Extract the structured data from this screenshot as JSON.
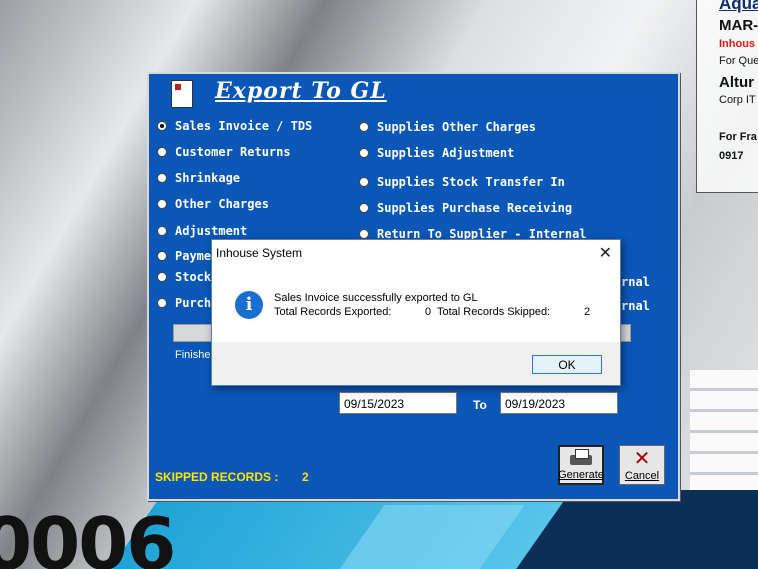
{
  "background": {
    "big_text": "0006",
    "info_panel": {
      "line1": "Aqua",
      "line2": "MAR-",
      "line3": "Inhous",
      "line4": "For Que",
      "line5": "Altur",
      "line6": "Corp IT",
      "line7": "For Fra",
      "line8": "0917"
    }
  },
  "window": {
    "title": "Export To GL",
    "options_left": [
      {
        "label": "Sales Invoice / TDS",
        "selected": true
      },
      {
        "label": "Customer Returns",
        "selected": false
      },
      {
        "label": "Shrinkage",
        "selected": false
      },
      {
        "label": "Other Charges",
        "selected": false
      },
      {
        "label": "Adjustment",
        "selected": false
      },
      {
        "label": "Payme",
        "selected": false
      },
      {
        "label": "Stock",
        "selected": false
      },
      {
        "label": "Purcha",
        "selected": false
      }
    ],
    "options_right": [
      {
        "label": "Supplies Other Charges",
        "selected": false
      },
      {
        "label": "Supplies Adjustment",
        "selected": false
      },
      {
        "label": "Supplies Stock Transfer In",
        "selected": false
      },
      {
        "label": "Supplies Purchase Receiving",
        "selected": false
      },
      {
        "label": "Return To Supplier - Internal",
        "selected": false
      },
      {
        "label": "rnal",
        "selected": false
      },
      {
        "label": "rnal",
        "selected": false
      }
    ],
    "status": "Finished",
    "start_date": "09/15/2023",
    "to_label": "To",
    "end_date": "09/19/2023",
    "skipped_label": "SKIPPED RECORDS :",
    "skipped_count": "2",
    "generate_label": "Generate",
    "cancel_label": "Cancel"
  },
  "dialog": {
    "title": "Inhouse System",
    "message_line1": "Sales Invoice successfully exported to GL",
    "exported_label": "Total Records Exported:",
    "exported_value": "0",
    "skipped_label": "Total Records Skipped:",
    "skipped_value": "2",
    "ok_label": "OK"
  }
}
